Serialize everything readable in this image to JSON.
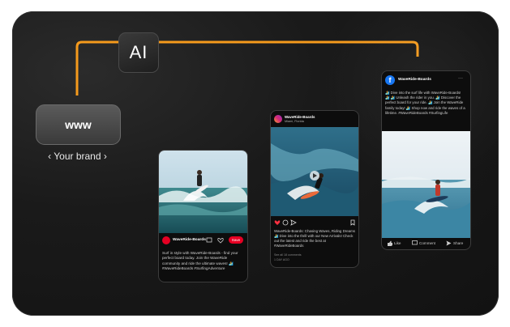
{
  "ai_label": "AI",
  "brand_button": "www",
  "brand_caption": "‹ Your brand ›",
  "colors": {
    "line_orange": "#f59a1c",
    "line_magenta": "#b21fd6",
    "pinterest_red": "#e60023",
    "facebook_blue": "#1877f2"
  },
  "pinterest": {
    "account": "WaveRide-Boards",
    "save": "Save",
    "caption": "Surf in style with WaveRide-Boards - find your perfect board today. Join the WaveRide community and ride the ultimate waves! 🏄 #WaveRideBoards #SurfingAdventure"
  },
  "instagram": {
    "account": "WaveRide-Boards",
    "location": "Miami, Florida",
    "caption": "WaveRide-Boards: Chasing Waves, Riding Dreams 🏄 Dive into the thrill with our New Arrivals! Check out the latest and ride the best at #WaveRideBoards",
    "meta_1": "See all 18 comments",
    "meta_2": "1 DAY AGO"
  },
  "facebook": {
    "account": "WaveRide-Boards",
    "more": "···",
    "caption": "🏄 Dive into the surf life with WaveRide-Boards! 🏄 🏄 Unleash the rider in you. 🏄 Discover the perfect board for your ride. 🏄 Join the WaveRide family today! 🏄 Shop now and ride the waves of a lifetime. #WaveRideBoards #SurfingLife",
    "actions": [
      "Like",
      "Comment",
      "Share"
    ]
  }
}
